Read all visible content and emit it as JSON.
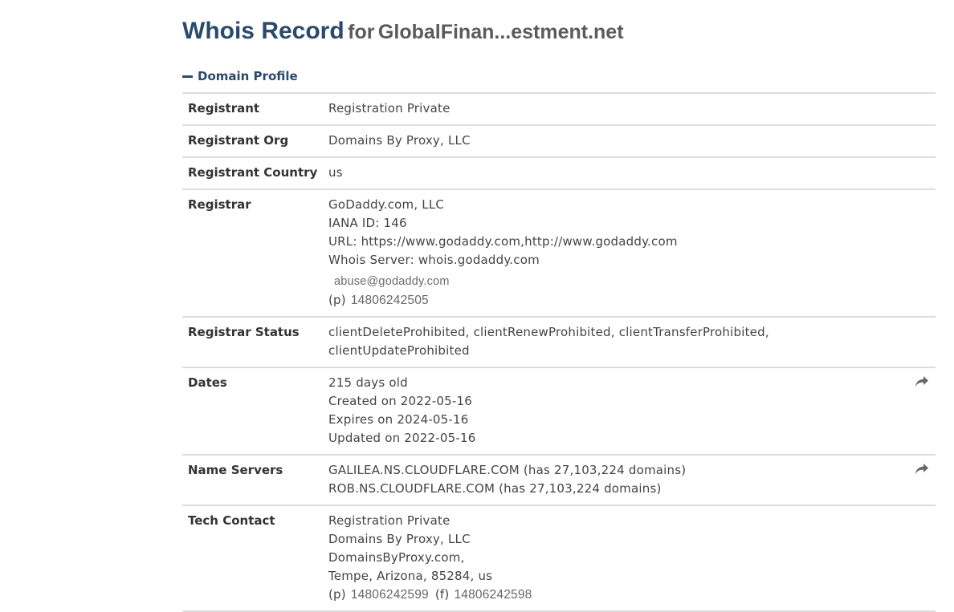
{
  "header": {
    "title_main": "Whois Record",
    "title_for": "for",
    "title_domain": "GlobalFinan...estment.net"
  },
  "section": {
    "label": "Domain Profile"
  },
  "rows": {
    "registrant": {
      "label": "Registrant",
      "value": "Registration Private"
    },
    "registrant_org": {
      "label": "Registrant Org",
      "value": "Domains By Proxy, LLC"
    },
    "registrant_country": {
      "label": "Registrant Country",
      "value": "us"
    },
    "registrar": {
      "label": "Registrar",
      "lines": [
        "GoDaddy.com, LLC",
        "IANA ID: 146",
        "URL: https://www.godaddy.com,http://www.godaddy.com",
        "Whois Server: whois.godaddy.com"
      ],
      "email_image_text": "abuse@godaddy.com",
      "phone_prefix": "(p)",
      "phone": "14806242505"
    },
    "registrar_status": {
      "label": "Registrar Status",
      "lines": [
        "clientDeleteProhibited, clientRenewProhibited, clientTransferProhibited,",
        "clientUpdateProhibited"
      ]
    },
    "dates": {
      "label": "Dates",
      "lines": [
        "215 days old",
        "Created on 2022-05-16",
        "Expires on 2024-05-16",
        "Updated on 2022-05-16"
      ]
    },
    "name_servers": {
      "label": "Name Servers",
      "lines": [
        "GALILEA.NS.CLOUDFLARE.COM (has 27,103,224 domains)",
        "ROB.NS.CLOUDFLARE.COM (has 27,103,224 domains)"
      ]
    },
    "tech_contact": {
      "label": "Tech Contact",
      "lines": [
        "Registration Private",
        "Domains By Proxy, LLC",
        "DomainsByProxy.com,",
        "Tempe, Arizona, 85284, us"
      ],
      "phone_prefix": "(p)",
      "phone": "14806242599",
      "fax_prefix": "(f)",
      "fax": "14806242598"
    }
  },
  "icons": {
    "share": "share-arrow-icon",
    "collapse": "minus-icon"
  },
  "colors": {
    "title": "#2b4a6b",
    "border": "#dddddd",
    "label": "#333333",
    "text": "#444444"
  }
}
